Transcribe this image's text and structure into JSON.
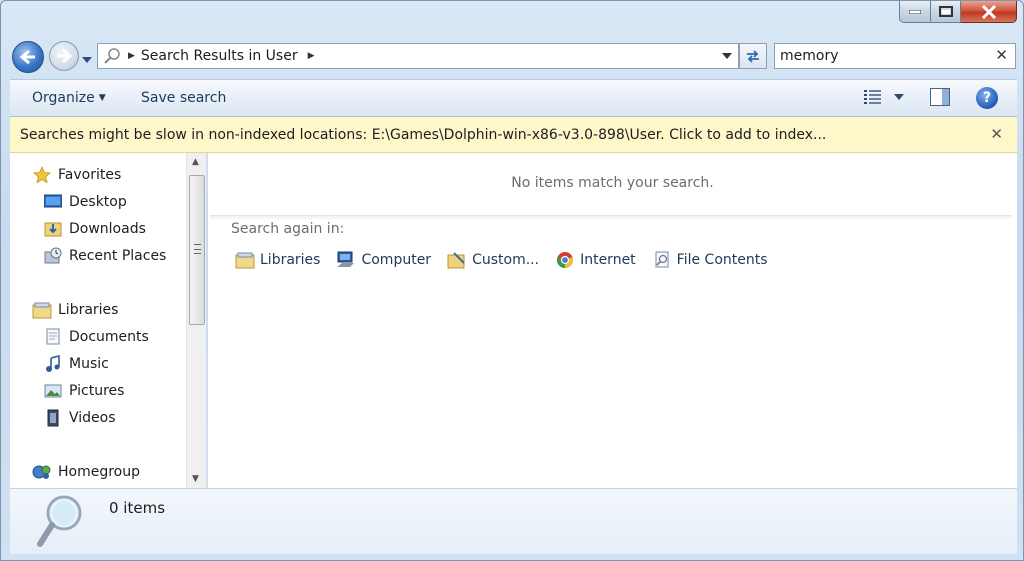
{
  "address": {
    "crumb": "Search Results in User"
  },
  "search": {
    "value": "memory"
  },
  "toolbar": {
    "organize_label": "Organize",
    "save_search_label": "Save search"
  },
  "infobar": {
    "message": "Searches might be slow in non-indexed locations: E:\\Games\\Dolphin-win-x86-v3.0-898\\User. Click to add to index..."
  },
  "sidebar": {
    "items": [
      {
        "label": "Favorites",
        "icon": "star-icon"
      },
      {
        "label": "Desktop",
        "icon": "desktop-icon"
      },
      {
        "label": "Downloads",
        "icon": "downloads-folder-icon"
      },
      {
        "label": "Recent Places",
        "icon": "recent-places-icon"
      },
      {
        "label": "Libraries",
        "icon": "libraries-icon"
      },
      {
        "label": "Documents",
        "icon": "documents-icon"
      },
      {
        "label": "Music",
        "icon": "music-icon"
      },
      {
        "label": "Pictures",
        "icon": "pictures-icon"
      },
      {
        "label": "Videos",
        "icon": "videos-icon"
      },
      {
        "label": "Homegroup",
        "icon": "homegroup-icon"
      }
    ]
  },
  "content": {
    "empty_message": "No items match your search.",
    "search_again_label": "Search again in:",
    "locations": [
      {
        "label": "Libraries",
        "icon": "libraries-icon"
      },
      {
        "label": "Computer",
        "icon": "computer-icon"
      },
      {
        "label": "Custom...",
        "icon": "custom-folder-icon"
      },
      {
        "label": "Internet",
        "icon": "internet-icon"
      },
      {
        "label": "File Contents",
        "icon": "file-contents-icon"
      }
    ]
  },
  "details": {
    "item_count": "0 items"
  },
  "colors": {
    "infobar_bg": "#fdf7c9",
    "accent": "#2f68b5",
    "close_button": "#c0391f"
  }
}
